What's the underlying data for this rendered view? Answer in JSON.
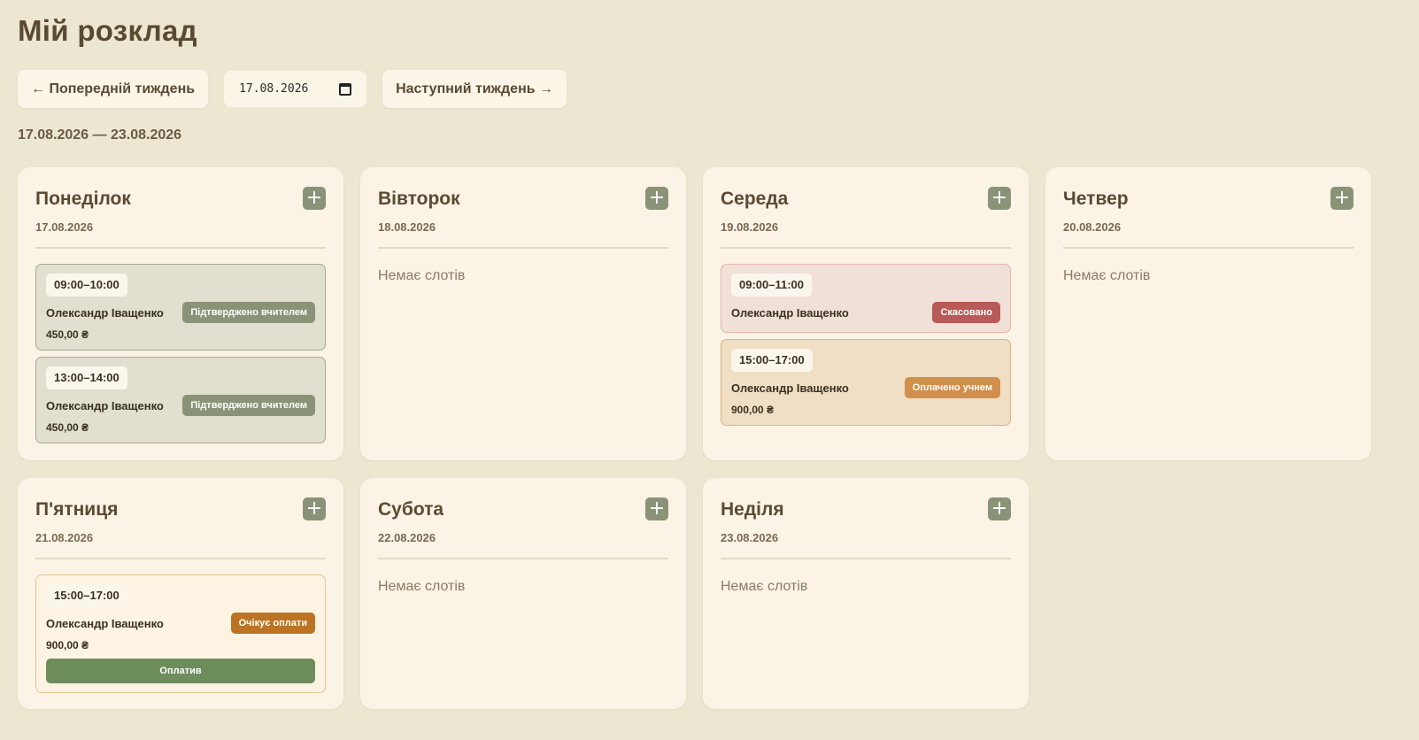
{
  "page": {
    "title": "Мій розклад"
  },
  "toolbar": {
    "prev_label": "← Попередній тиждень",
    "date_value": "17.08.2026",
    "next_label": "Наступний тиждень →"
  },
  "week_range": "17.08.2026 — 23.08.2026",
  "colors": {
    "background": "#ede7d2",
    "card": "#fbf3e5",
    "add_button": "#8a9378",
    "confirmed_badge": "#8a9378",
    "cancelled_badge": "#b85a57",
    "paid_badge": "#d18f4c",
    "pending_badge": "#ba7424",
    "pay_button": "#6d8d5b"
  },
  "days": [
    {
      "name": "Понеділок",
      "date": "17.08.2026",
      "add_icon": "plus-icon",
      "empty_label": "",
      "slots": [
        {
          "time": "09:00–10:00",
          "student": "Олександр Іващенко",
          "status": "Підтверджено вчителем",
          "status_type": "confirmed",
          "price": "450,00 ₴",
          "action": ""
        },
        {
          "time": "13:00–14:00",
          "student": "Олександр Іващенко",
          "status": "Підтверджено вчителем",
          "status_type": "confirmed",
          "price": "450,00 ₴",
          "action": ""
        }
      ]
    },
    {
      "name": "Вівторок",
      "date": "18.08.2026",
      "add_icon": "plus-icon",
      "empty_label": "Немає слотів",
      "slots": []
    },
    {
      "name": "Середа",
      "date": "19.08.2026",
      "add_icon": "plus-icon",
      "empty_label": "",
      "slots": [
        {
          "time": "09:00–11:00",
          "student": "Олександр Іващенко",
          "status": "Скасовано",
          "status_type": "cancelled",
          "price": "",
          "action": ""
        },
        {
          "time": "15:00–17:00",
          "student": "Олександр Іващенко",
          "status": "Оплачено учнем",
          "status_type": "paid",
          "price": "900,00 ₴",
          "action": ""
        }
      ]
    },
    {
      "name": "Четвер",
      "date": "20.08.2026",
      "add_icon": "plus-icon",
      "empty_label": "Немає слотів",
      "slots": []
    },
    {
      "name": "П'ятниця",
      "date": "21.08.2026",
      "add_icon": "plus-icon",
      "empty_label": "",
      "slots": [
        {
          "time": "15:00–17:00",
          "student": "Олександр Іващенко",
          "status": "Очікує оплати",
          "status_type": "pending",
          "price": "900,00 ₴",
          "action": "Оплатив"
        }
      ]
    },
    {
      "name": "Субота",
      "date": "22.08.2026",
      "add_icon": "plus-icon",
      "empty_label": "Немає слотів",
      "slots": []
    },
    {
      "name": "Неділя",
      "date": "23.08.2026",
      "add_icon": "plus-icon",
      "empty_label": "Немає слотів",
      "slots": []
    }
  ]
}
